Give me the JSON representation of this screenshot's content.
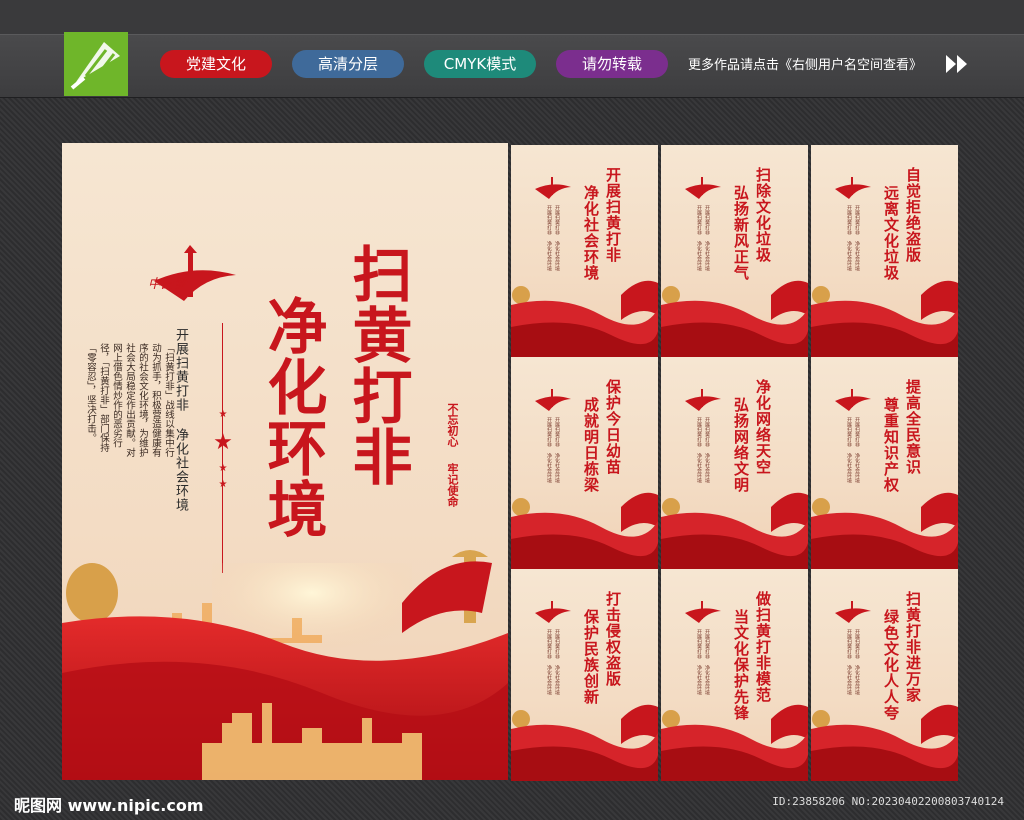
{
  "toolbar": {
    "tags": [
      {
        "label": "党建文化",
        "color": "#c8161d"
      },
      {
        "label": "高清分层",
        "color": "#3f6a9a"
      },
      {
        "label": "CMYK模式",
        "color": "#1e8a7a"
      },
      {
        "label": "请勿转载",
        "color": "#7b2e8e"
      }
    ],
    "more_text": "更多作品请点击《右侧用户名空间查看》"
  },
  "main_poster": {
    "logo_text": "中国梦",
    "title_line1": "扫黄打非",
    "title_line2": "净化环境",
    "subtitle": "开展扫黄打非 净化社会环境",
    "seal_line1": "不忘初心",
    "seal_line2": "牢记使命",
    "body": "「扫黄打非」战线以集中行动为抓手，积极营造健康有序的社会文化环境，为维护社会大局稳定作出贡献。对网上借色情炒作的恶劣行径，「扫黄打非」部门保持「零容忍」，坚决打击。"
  },
  "small_posters": [
    {
      "line1": "开展扫黄打非",
      "line2": "净化社会环境"
    },
    {
      "line1": "扫除文化垃圾",
      "line2": "弘扬新风正气"
    },
    {
      "line1": "自觉拒绝盗版",
      "line2": "远离文化垃圾"
    },
    {
      "line1": "保护今日幼苗",
      "line2": "成就明日栋梁"
    },
    {
      "line1": "净化网络天空",
      "line2": "弘扬网络文明"
    },
    {
      "line1": "提高全民意识",
      "line2": "尊重知识产权"
    },
    {
      "line1": "打击侵权盗版",
      "line2": "保护民族创新"
    },
    {
      "line1": "做扫黄打非模范",
      "line2": "当文化保护先锋"
    },
    {
      "line1": "扫黄打非进万家",
      "line2": "绿色文化人人夸"
    }
  ],
  "small_body": "开展扫黄打非 净化社会环境",
  "footer": {
    "site": "昵图网 www.nipic.com",
    "id": "ID:23858206 NO:20230402200803740124"
  },
  "colors": {
    "accent": "#c8161d",
    "poster_bg": "#f5e3cf"
  }
}
